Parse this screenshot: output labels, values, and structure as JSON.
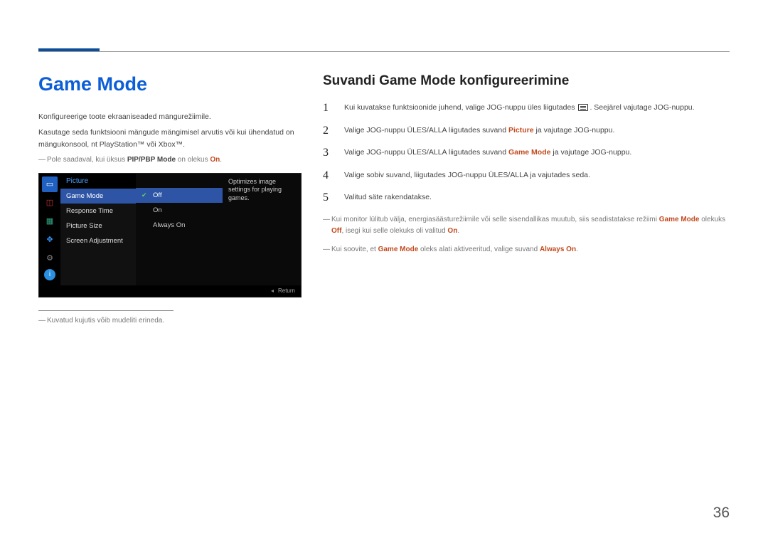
{
  "page_number": "36",
  "left": {
    "title": "Game Mode",
    "p1": "Konfigureerige toote ekraaniseaded mängurežiimile.",
    "p2": "Kasutage seda funktsiooni mängude mängimisel arvutis või kui ühendatud on mängukonsool, nt PlayStation™ või Xbox™.",
    "note1_pre": "Pole saadaval, kui üksus ",
    "note1_bold": "PIP/PBP Mode",
    "note1_mid": " on olekus ",
    "note1_emph": "On",
    "note1_post": ".",
    "footnote": "Kuvatud kujutis võib mudeliti erineda."
  },
  "osd": {
    "header": "Picture",
    "items": [
      "Game Mode",
      "Response Time",
      "Picture Size",
      "Screen Adjustment"
    ],
    "opts": [
      "Off",
      "On",
      "Always On"
    ],
    "desc": "Optimizes image settings for playing games.",
    "return": "Return",
    "icons": {
      "monitor": "monitor-icon",
      "pip": "pip-icon",
      "picture": "picture-icon",
      "move": "move-icon",
      "gear": "gear-icon",
      "info": "info-icon"
    }
  },
  "right": {
    "title": "Suvandi Game Mode konfigureerimine",
    "steps": {
      "s1_pre": "Kui kuvatakse funktsioonide juhend, valige JOG-nuppu üles liigutades ",
      "s1_post": ". Seejärel vajutage JOG-nuppu.",
      "s2_pre": "Valige JOG-nuppu ÜLES/ALLA liigutades suvand ",
      "s2_bold": "Picture",
      "s2_post": " ja vajutage JOG-nuppu.",
      "s3_pre": "Valige JOG-nuppu ÜLES/ALLA liigutades suvand ",
      "s3_bold": "Game Mode",
      "s3_post": " ja vajutage JOG-nuppu.",
      "s4": "Valige sobiv suvand, liigutades JOG-nuppu ÜLES/ALLA ja vajutades seda.",
      "s5": "Valitud säte rakendatakse."
    },
    "note2_pre": "Kui monitor lülitub välja, energiasäästurežiimile või selle sisendallikas muutub, siis seadistatakse režiimi ",
    "note2_b1": "Game Mode",
    "note2_mid1": " olekuks ",
    "note2_b2": "Off",
    "note2_mid2": ", isegi kui selle olekuks oli valitud ",
    "note2_b3": "On",
    "note2_post": ".",
    "note3_pre": "Kui soovite, et ",
    "note3_b1": "Game Mode",
    "note3_mid": " oleks alati aktiveeritud, valige suvand ",
    "note3_b2": "Always On",
    "note3_post": "."
  }
}
